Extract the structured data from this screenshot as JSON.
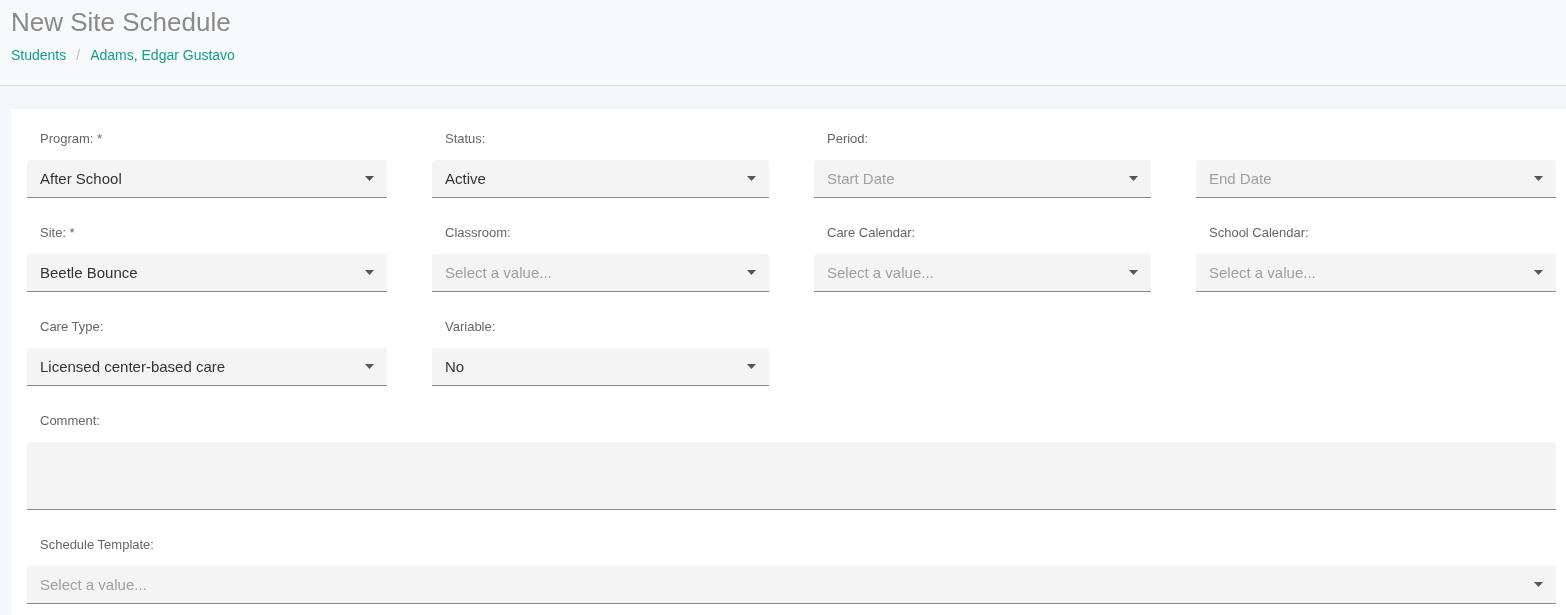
{
  "page": {
    "title": "New Site Schedule"
  },
  "breadcrumb_separator": "/",
  "breadcrumb": [
    {
      "label": "Students"
    },
    {
      "label": "Adams, Edgar Gustavo"
    }
  ],
  "rows": [
    [
      {
        "label": "Program: *",
        "value": "After School"
      },
      {
        "label": "Status:",
        "value": "Active"
      },
      {
        "label": "Period:",
        "placeholder": "Start Date"
      },
      {
        "placeholder": "End Date"
      }
    ],
    [
      {
        "label": "Site: *",
        "value": "Beetle Bounce"
      },
      {
        "label": "Classroom:",
        "placeholder": "Select a value..."
      },
      {
        "label": "Care Calendar:",
        "placeholder": "Select a value..."
      },
      {
        "label": "School Calendar:",
        "placeholder": "Select a value..."
      }
    ],
    [
      {
        "label": "Care Type:",
        "value": "Licensed center-based care"
      },
      {
        "label": "Variable:",
        "value": "No"
      }
    ]
  ],
  "comment": {
    "label": "Comment:"
  },
  "schedule_template": {
    "label": "Schedule Template:",
    "placeholder": "Select a value..."
  }
}
